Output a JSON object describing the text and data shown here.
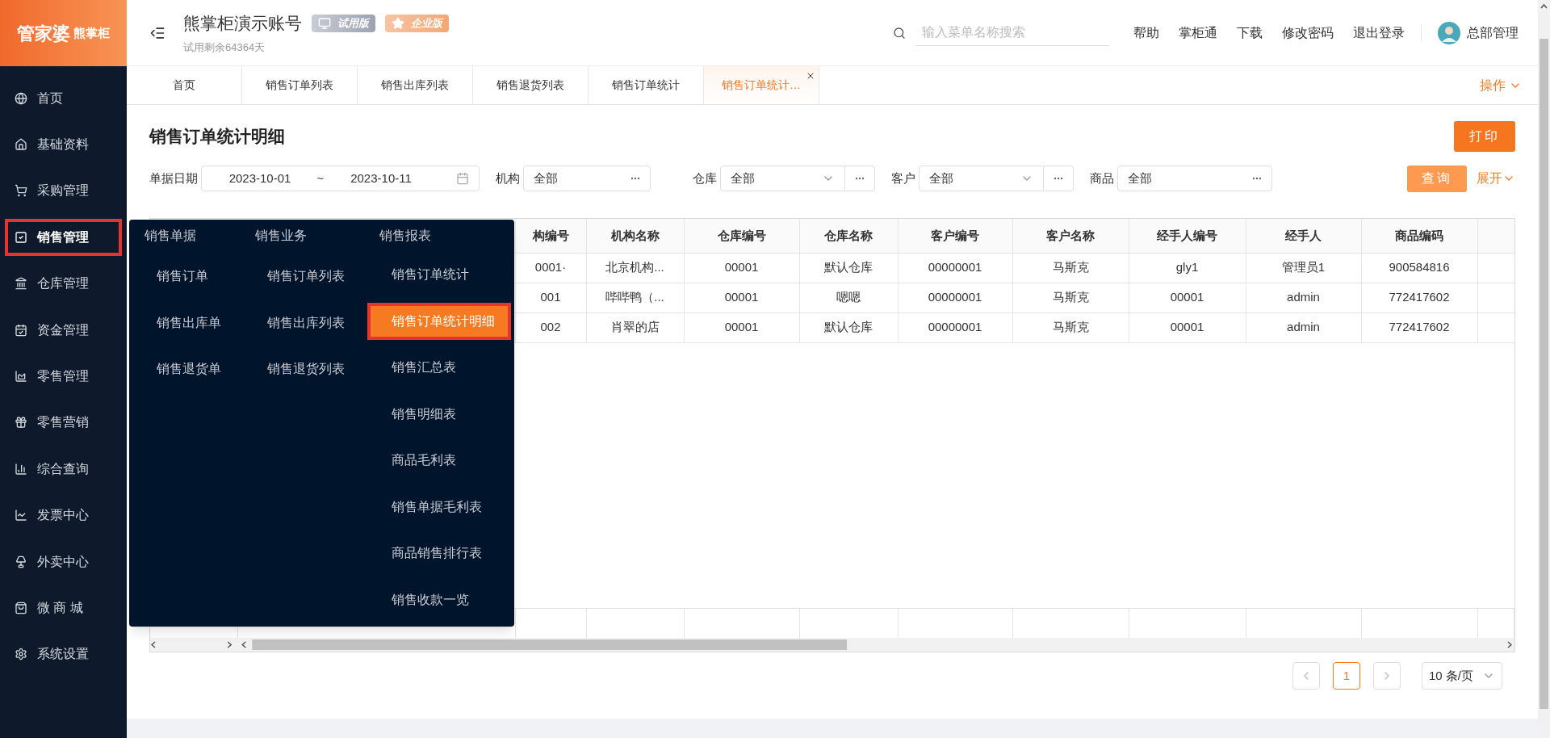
{
  "sidebar": {
    "logo": {
      "brand": "管家婆",
      "product": "熊掌柜"
    },
    "items": [
      {
        "label": "首页",
        "selected": false,
        "highlighted": false
      },
      {
        "label": "基础资料",
        "selected": false,
        "highlighted": false
      },
      {
        "label": "采购管理",
        "selected": false,
        "highlighted": false
      },
      {
        "label": "销售管理",
        "selected": true,
        "highlighted": true
      },
      {
        "label": "仓库管理",
        "selected": false,
        "highlighted": false
      },
      {
        "label": "资金管理",
        "selected": false,
        "highlighted": false
      },
      {
        "label": "零售管理",
        "selected": false,
        "highlighted": false
      },
      {
        "label": "零售营销",
        "selected": false,
        "highlighted": false
      },
      {
        "label": "综合查询",
        "selected": false,
        "highlighted": false
      },
      {
        "label": "发票中心",
        "selected": false,
        "highlighted": false
      },
      {
        "label": "外卖中心",
        "selected": false,
        "highlighted": false
      },
      {
        "label": "微 商 城",
        "selected": false,
        "highlighted": false
      },
      {
        "label": "系统设置",
        "selected": false,
        "highlighted": false
      }
    ]
  },
  "header": {
    "account": "熊掌柜演示账号",
    "badges": [
      {
        "label": "试用版",
        "kind": "trial"
      },
      {
        "label": "企业版",
        "kind": "enterprise"
      }
    ],
    "trial_note": "试用剩余64364天",
    "search": {
      "placeholder": "输入菜单名称搜索"
    },
    "links": [
      "帮助",
      "掌柜通",
      "下载",
      "修改密码",
      "退出登录"
    ],
    "user": "总部管理"
  },
  "tabs": [
    {
      "label": "首页",
      "selected": false
    },
    {
      "label": "销售订单列表",
      "selected": false
    },
    {
      "label": "销售出库列表",
      "selected": false
    },
    {
      "label": "销售退货列表",
      "selected": false
    },
    {
      "label": "销售订单统计",
      "selected": false
    },
    {
      "label": "销售订单统计…",
      "selected": true
    }
  ],
  "tab_actions": "操作",
  "page": {
    "title": "销售订单统计明细",
    "print_button": "打印",
    "filters": [
      {
        "kind": "daterange",
        "label": "单据日期",
        "from": "2023-10-01",
        "separator": "~",
        "to": "2023-10-11"
      },
      {
        "kind": "picker",
        "label": "机构",
        "value": "全部"
      },
      {
        "kind": "select",
        "label": "仓库",
        "value": "全部"
      },
      {
        "kind": "select",
        "label": "客户",
        "value": "全部"
      },
      {
        "kind": "picker",
        "label": "商品",
        "value": "全部"
      }
    ],
    "query_button": "查询",
    "expand_link": "展开"
  },
  "table": {
    "columns": [
      "构编号",
      "机构名称",
      "仓库编号",
      "仓库名称",
      "客户编号",
      "客户名称",
      "经手人编号",
      "经手人",
      "商品编码"
    ],
    "rows": [
      [
        "0001·",
        "北京机构...",
        "00001",
        "默认仓库",
        "00000001",
        "马斯克",
        "gly1",
        "管理员1",
        "900584816"
      ],
      [
        "001",
        "哔哔鸭（...",
        "00001",
        "嗯嗯",
        "00000001",
        "马斯克",
        "00001",
        "admin",
        "772417602"
      ],
      [
        "002",
        "肖翠的店",
        "00001",
        "默认仓库",
        "00000001",
        "马斯克",
        "00001",
        "admin",
        "772417602"
      ]
    ]
  },
  "pagination": {
    "pages": [
      {
        "label": "1",
        "selected": true
      }
    ],
    "page_size": "10 条/页"
  },
  "mega_menu": {
    "columns": [
      {
        "heading": "销售单据",
        "items": [
          {
            "label": "销售订单",
            "selected": false,
            "highlighted": false
          },
          {
            "label": "销售出库单",
            "selected": false,
            "highlighted": false
          },
          {
            "label": "销售退货单",
            "selected": false,
            "highlighted": false
          }
        ]
      },
      {
        "heading": "销售业务",
        "items": [
          {
            "label": "销售订单列表",
            "selected": false,
            "highlighted": false
          },
          {
            "label": "销售出库列表",
            "selected": false,
            "highlighted": false
          },
          {
            "label": "销售退货列表",
            "selected": false,
            "highlighted": false
          }
        ]
      },
      {
        "heading": "销售报表",
        "items": [
          {
            "label": "销售订单统计",
            "selected": false,
            "highlighted": false
          },
          {
            "label": "销售订单统计明细",
            "selected": true,
            "highlighted": true
          },
          {
            "label": "销售汇总表",
            "selected": false,
            "highlighted": false
          },
          {
            "label": "销售明细表",
            "selected": false,
            "highlighted": false
          },
          {
            "label": "商品毛利表",
            "selected": false,
            "highlighted": false
          },
          {
            "label": "销售单据毛利表",
            "selected": false,
            "highlighted": false
          },
          {
            "label": "商品销售排行表",
            "selected": false,
            "highlighted": false
          },
          {
            "label": "销售收款一览",
            "selected": false,
            "highlighted": false
          }
        ]
      }
    ]
  }
}
